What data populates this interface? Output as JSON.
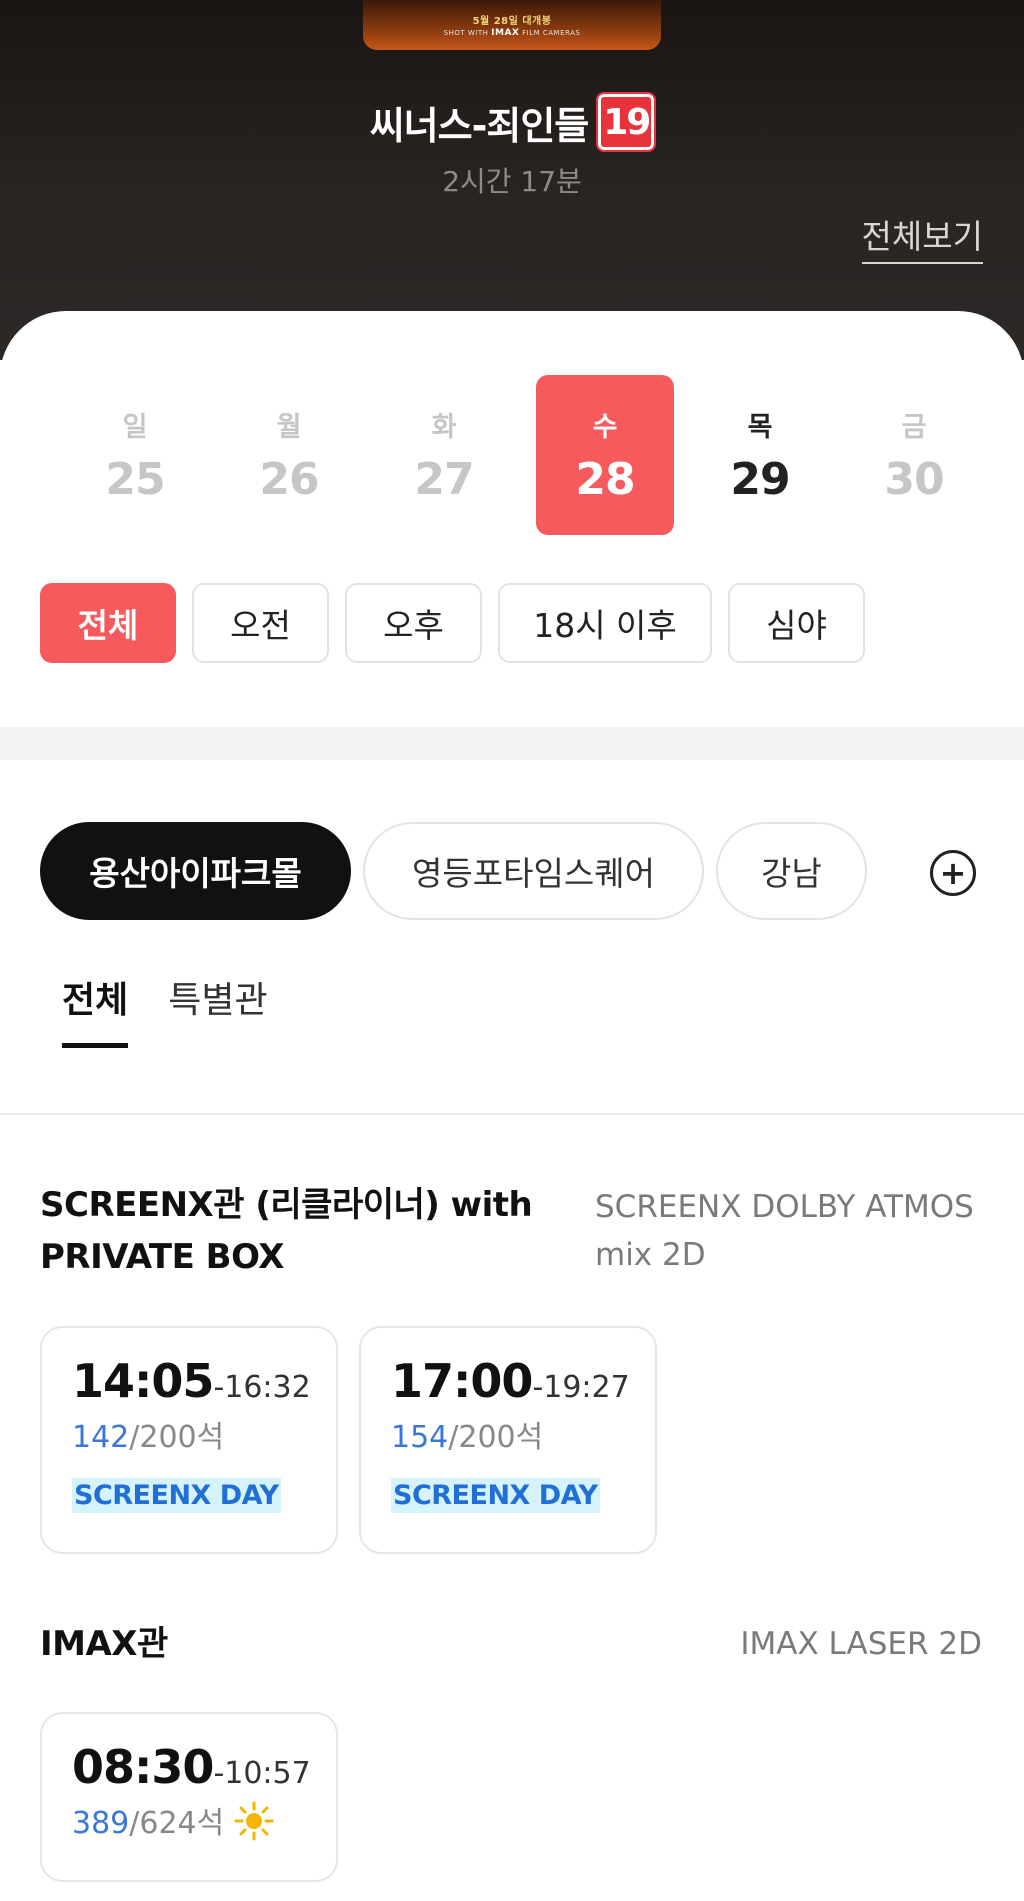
{
  "poster": {
    "release_text": "5월 28일 대개봉",
    "shot_prefix": "SHOT WITH",
    "shot_brand": "IMAX",
    "shot_suffix": "FILM CAMERAS"
  },
  "movie": {
    "title": "씨너스-죄인들",
    "age_rating": "19",
    "runtime": "2시간 17분",
    "view_all": "전체보기"
  },
  "dates": [
    {
      "dow": "일",
      "day": "25",
      "state": "disabled"
    },
    {
      "dow": "월",
      "day": "26",
      "state": "disabled"
    },
    {
      "dow": "화",
      "day": "27",
      "state": "disabled"
    },
    {
      "dow": "수",
      "day": "28",
      "state": "selected"
    },
    {
      "dow": "목",
      "day": "29",
      "state": "available"
    },
    {
      "dow": "금",
      "day": "30",
      "state": "disabled"
    }
  ],
  "time_filters": [
    {
      "label": "전체",
      "active": true
    },
    {
      "label": "오전",
      "active": false
    },
    {
      "label": "오후",
      "active": false
    },
    {
      "label": "18시 이후",
      "active": false
    },
    {
      "label": "심야",
      "active": false
    }
  ],
  "theaters": [
    {
      "label": "용산아이파크몰",
      "active": true
    },
    {
      "label": "영등포타임스퀘어",
      "active": false
    },
    {
      "label": "강남",
      "active": false
    }
  ],
  "add_theater_icon": "plus-circle-icon",
  "type_tabs": [
    {
      "label": "전체",
      "active": true
    },
    {
      "label": "특별관",
      "active": false
    }
  ],
  "auditoriums": [
    {
      "name_line1": "SCREENX관 (리클라이너) with",
      "name_line2": "PRIVATE BOX",
      "format_line1": "SCREENX DOLBY ATMOS",
      "format_line2": "mix 2D",
      "slots": [
        {
          "start": "14:05",
          "end": "-16:32",
          "seats_left": "142",
          "seats_total": "/200석",
          "tag": "SCREENX DAY"
        },
        {
          "start": "17:00",
          "end": "-19:27",
          "seats_left": "154",
          "seats_total": "/200석",
          "tag": "SCREENX DAY"
        }
      ]
    },
    {
      "name_line1": "IMAX관",
      "format_line1": "IMAX LASER 2D",
      "slots": [
        {
          "start": "08:30",
          "end": "-10:57",
          "seats_left": "389",
          "seats_total": "/624석",
          "icon": "sun-icon",
          "icon_color": "#f5b400"
        }
      ]
    }
  ],
  "colors": {
    "accent": "#f75a5d",
    "seats_left": "#3a77d8",
    "tag_text": "#1f6fd6",
    "tag_bg": "#d6f2fb",
    "age_badge": "#e8323c"
  }
}
